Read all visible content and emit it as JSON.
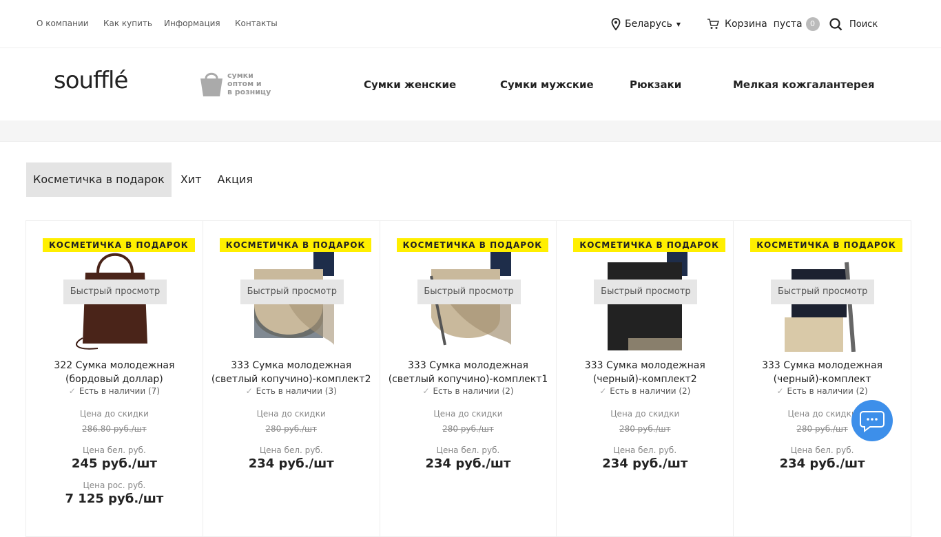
{
  "topnav": [
    "О компании",
    "Как купить",
    "Информация",
    "Контакты"
  ],
  "region": "Беларусь",
  "cart": {
    "label": "Корзина",
    "status": "пуста",
    "count": "0"
  },
  "search": "Поиск",
  "logo": "soufflé",
  "logo2": [
    "сумки",
    "оптом и",
    "в розницу"
  ],
  "mainnav": [
    "Сумки женские",
    "Сумки мужские",
    "Рюкзаки",
    "Мелкая кожгалантерея"
  ],
  "tabs": [
    "Косметичка в подарок",
    "Хит",
    "Акция"
  ],
  "sticker": "Косметичка в подарок",
  "quick_view": "Быстрый просмотр",
  "labels": {
    "before": "Цена до скидки",
    "by": "Цена бел. руб.",
    "ru": "Цена рос. руб."
  },
  "products": [
    {
      "title": "322 Сумка молодежная (бордовый доллар)",
      "stock": "Есть в наличии (7)",
      "old": "286.80 руб./шт",
      "price": "245 руб./шт",
      "price_ru": "7 125 руб./шт",
      "color": "#4a2419"
    },
    {
      "title": "333 Сумка молодежная (светлый копучино)-комплект2",
      "stock": "Есть в наличии (3)",
      "old": "280 руб./шт",
      "price": "234 руб./шт",
      "color": "#c9b99c"
    },
    {
      "title": "333 Сумка молодежная (светлый копучино)-комплект1",
      "stock": "Есть в наличии (2)",
      "old": "280 руб./шт",
      "price": "234 руб./шт",
      "color": "#c9b99c"
    },
    {
      "title": "333 Сумка молодежная (черный)-комплект2",
      "stock": "Есть в наличии (2)",
      "old": "280 руб./шт",
      "price": "234 руб./шт",
      "color": "#222222"
    },
    {
      "title": "333 Сумка молодежная (черный)-комплект",
      "stock": "Есть в наличии (2)",
      "old": "280 руб./шт",
      "price": "234 руб./шт",
      "color": "#1c2130"
    }
  ],
  "colors": {
    "sticker": "#ffef00",
    "chat": "#3d8fea",
    "tab_active": "#e4e4e4"
  },
  "chat_icon": "chat-icon"
}
